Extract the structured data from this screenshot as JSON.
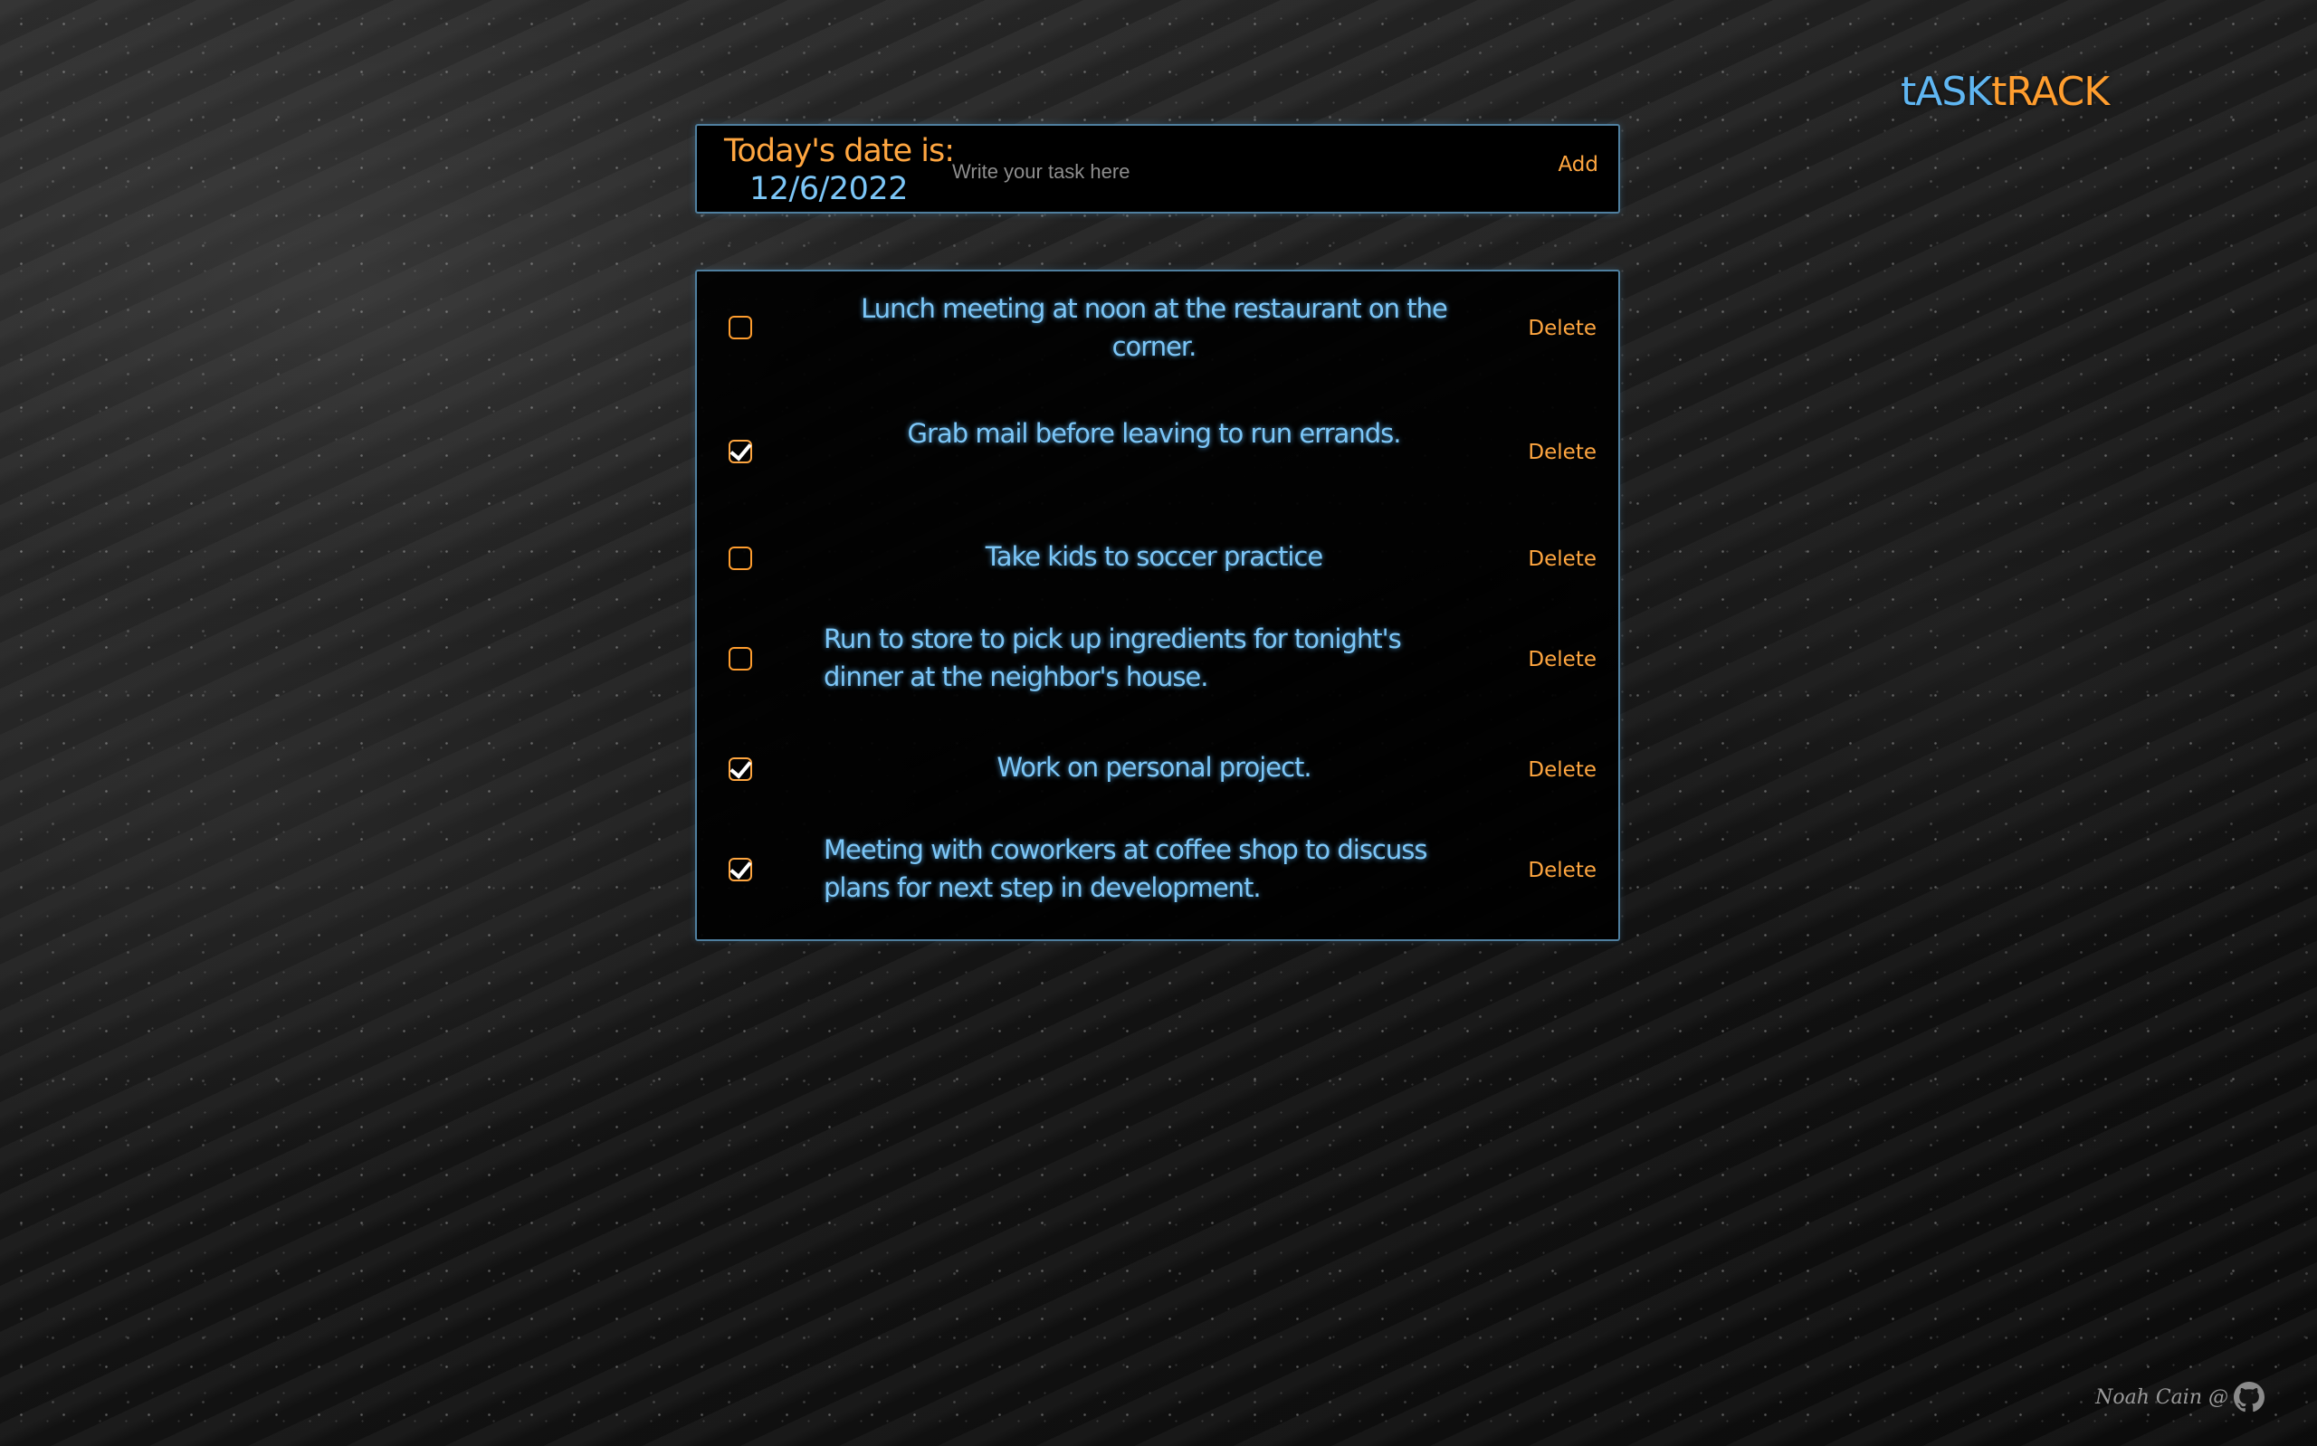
{
  "brand": {
    "part1": "tASK",
    "part2": "tRACK"
  },
  "header": {
    "date_label": "Today's date is:",
    "date_value": "12/6/2022",
    "input_placeholder": "Write your task here",
    "input_value": "",
    "add_label": "Add"
  },
  "tasks": [
    {
      "text": "Lunch meeting at noon at the restaurant on the corner.",
      "checked": false,
      "delete_label": "Delete"
    },
    {
      "text": "Grab mail before leaving to run errands.",
      "checked": true,
      "delete_label": "Delete"
    },
    {
      "text": "Take kids to soccer practice",
      "checked": false,
      "delete_label": "Delete"
    },
    {
      "text": "Run to store to pick up ingredients for tonight's dinner at the neighbor's house.",
      "checked": false,
      "delete_label": "Delete"
    },
    {
      "text": "Work on personal project.",
      "checked": true,
      "delete_label": "Delete"
    },
    {
      "text": "Meeting with coworkers at coffee shop to discuss plans for next step in development.",
      "checked": true,
      "delete_label": "Delete"
    }
  ],
  "footer": {
    "signature": "Noah Cain @",
    "icon": "github-icon"
  },
  "colors": {
    "accent_orange": "#ffa640",
    "accent_blue": "#7cc6f7",
    "border": "#4f7f9f"
  }
}
